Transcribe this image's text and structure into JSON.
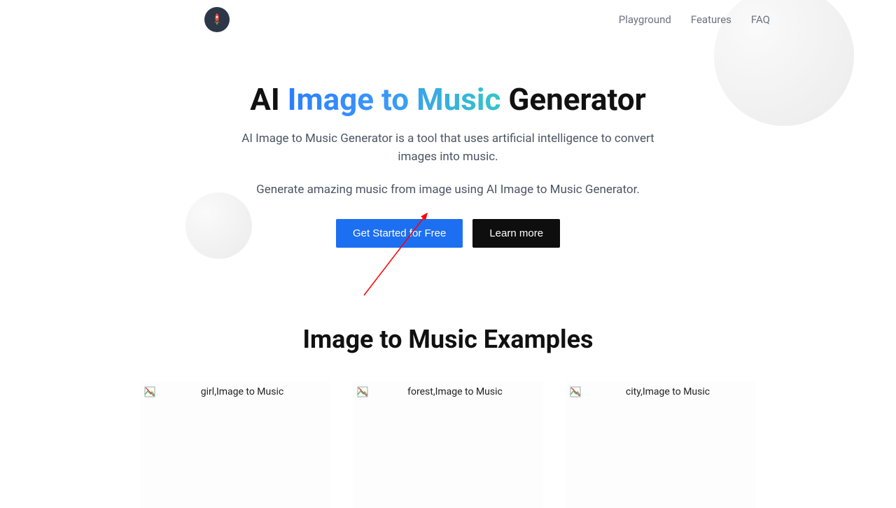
{
  "nav": {
    "items": [
      {
        "label": "Playground"
      },
      {
        "label": "Features"
      },
      {
        "label": "FAQ"
      }
    ]
  },
  "hero": {
    "title_prefix": "AI ",
    "title_gradient": "Image to Music",
    "title_suffix": " Generator",
    "description": "AI Image to Music Generator is a tool that uses artificial intelligence to convert images into music.",
    "subline": "Generate amazing music from image using AI Image to Music Generator.",
    "cta_primary": "Get Started for Free",
    "cta_secondary": "Learn more"
  },
  "examples": {
    "title": "Image to Music Examples",
    "cards": [
      {
        "alt": "girl,Image to Music"
      },
      {
        "alt": "forest,Image to Music"
      },
      {
        "alt": "city,Image to Music"
      }
    ]
  }
}
